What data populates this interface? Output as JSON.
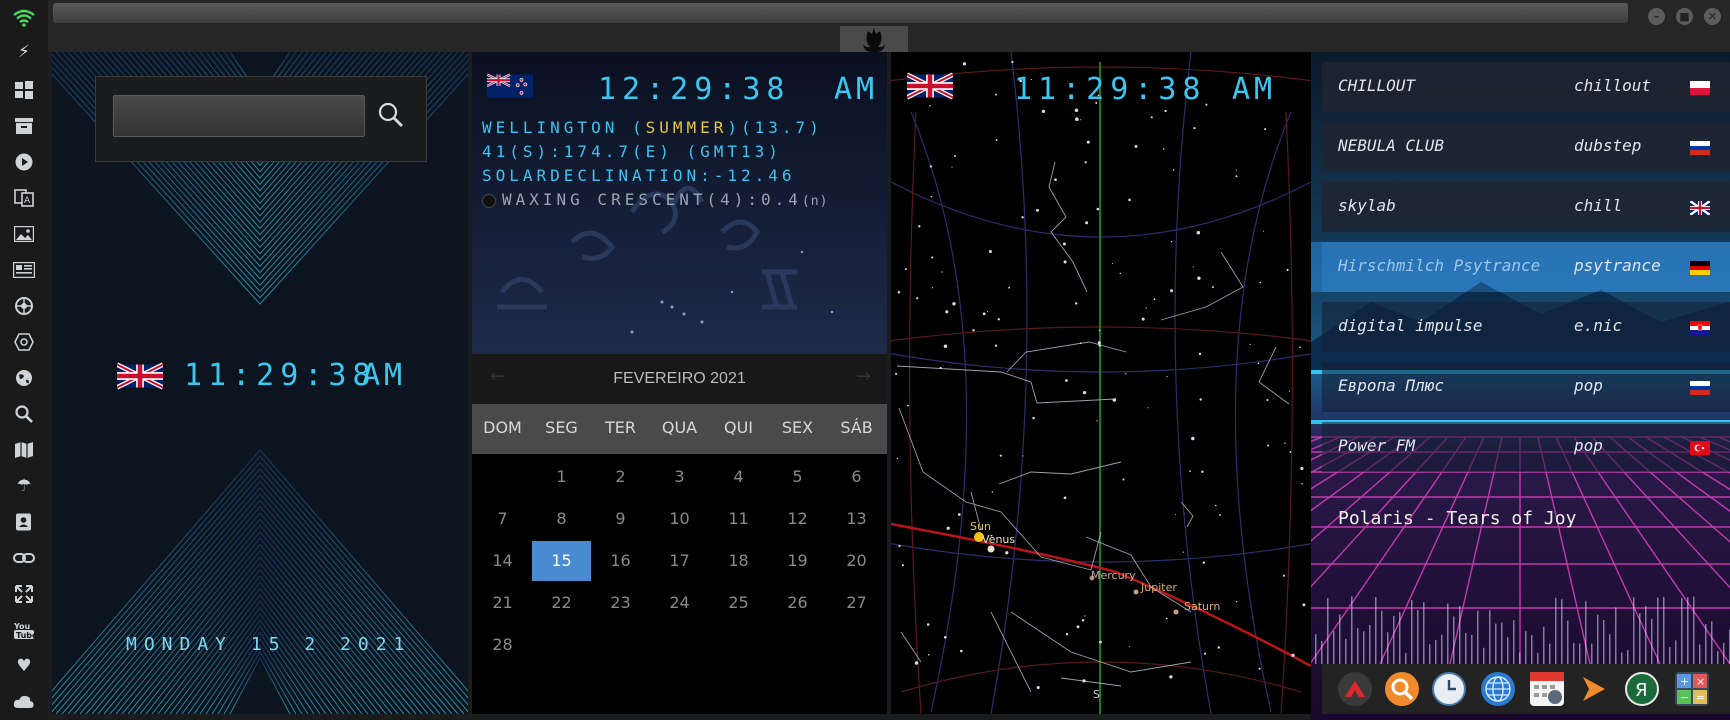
{
  "rail": {
    "icons": [
      "wifi-icon",
      "lightning-icon",
      "windows-icon",
      "archive-icon",
      "play-icon",
      "translate-icon",
      "image-icon",
      "news-icon",
      "rebel-icon",
      "nodes-icon",
      "globe-icon",
      "search-icon",
      "map-icon",
      "umbrella-icon",
      "contacts-icon",
      "link-icon",
      "expand-icon",
      "youtube-icon",
      "heart-icon",
      "cloud-icon"
    ]
  },
  "window": {
    "buttons": [
      "minimize-icon",
      "maximize-icon",
      "close-icon"
    ]
  },
  "panel1": {
    "search_placeholder": "",
    "clock_time": "11:29:38",
    "clock_ampm": "AM",
    "date_text": "MONDAY 15 2 2021"
  },
  "panel2": {
    "time": "12:29:38",
    "ampm": "AM",
    "line1_prefix": "WELLINGTON (",
    "line1_season": "SUMMER",
    "line1_suffix": ")(13.7)",
    "line2": "41(S):174.7(E) (GMT13)",
    "line3": "SOLARDECLINATION:-12.46",
    "line4": "WAXING CRESCENT(4):0.4",
    "line4_unit": "(n)",
    "calendar": {
      "month_label": "FEVEREIRO 2021",
      "prev": "←",
      "next": "→",
      "day_names": [
        "DOM",
        "SEG",
        "TER",
        "QUA",
        "QUI",
        "SEX",
        "SÁB"
      ],
      "weeks": [
        [
          "",
          "1",
          "2",
          "3",
          "4",
          "5",
          "6"
        ],
        [
          "7",
          "8",
          "9",
          "10",
          "11",
          "12",
          "13"
        ],
        [
          "14",
          "15",
          "16",
          "17",
          "18",
          "19",
          "20"
        ],
        [
          "21",
          "22",
          "23",
          "24",
          "25",
          "26",
          "27"
        ],
        [
          "28",
          "",
          "",
          "",
          "",
          "",
          ""
        ]
      ],
      "selected_day": "15"
    }
  },
  "panel3": {
    "time": "11:29:38",
    "ampm": "AM",
    "planets": [
      "Sun",
      "Venus",
      "Mercury",
      "Jupiter",
      "Saturn"
    ],
    "compass_label": "S"
  },
  "panel4": {
    "stations": [
      {
        "name": "CHILLOUT",
        "genre": "chillout",
        "flag": "poland"
      },
      {
        "name": "NEBULA CLUB",
        "genre": "dubstep",
        "flag": "russia"
      },
      {
        "name": "skylab",
        "genre": "chill",
        "flag": "uk"
      },
      {
        "name": "Hirschmilch Psytrance",
        "genre": "psytrance",
        "flag": "germany"
      },
      {
        "name": "digital impulse",
        "genre": "e.nic",
        "flag": "croatia"
      },
      {
        "name": "Европа Плюс",
        "genre": "pop",
        "flag": "russia"
      },
      {
        "name": "Power FM",
        "genre": "pop",
        "flag": "turkey"
      }
    ],
    "now_playing": "Polaris - Tears of Joy",
    "dock_icons": [
      "app-red-icon",
      "search-orange-icon",
      "clock-app-icon",
      "globe-app-icon",
      "calendar-app-icon",
      "arrow-app-icon",
      "yandex-icon",
      "calculator-icon"
    ]
  }
}
